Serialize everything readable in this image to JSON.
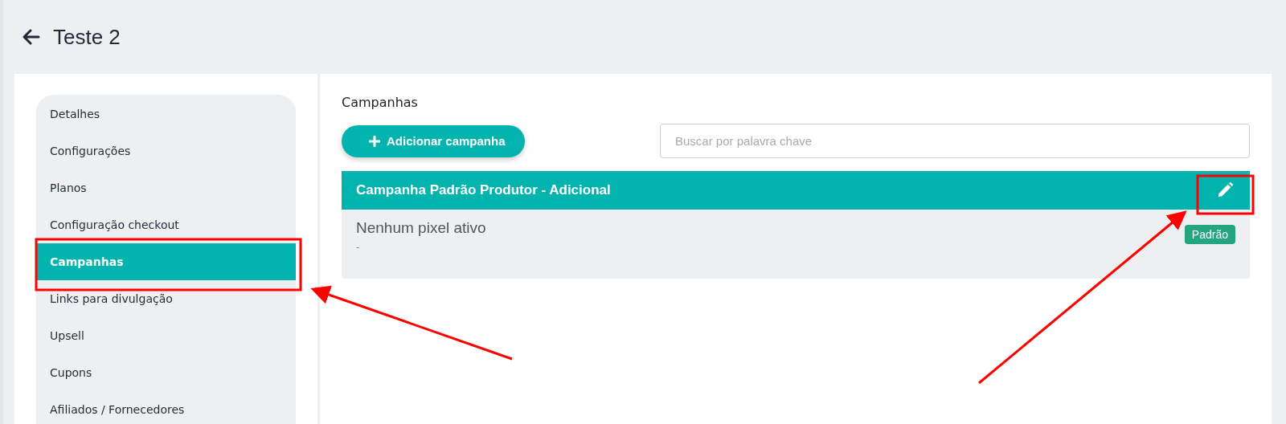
{
  "page": {
    "title": "Teste 2"
  },
  "sidebar": {
    "items": [
      {
        "label": "Detalhes",
        "selected": false
      },
      {
        "label": "Configurações",
        "selected": false
      },
      {
        "label": "Planos",
        "selected": false
      },
      {
        "label": "Configuração checkout",
        "selected": false
      },
      {
        "label": "Campanhas",
        "selected": true
      },
      {
        "label": "Links para divulgação",
        "selected": false
      },
      {
        "label": "Upsell",
        "selected": false
      },
      {
        "label": "Cupons",
        "selected": false
      },
      {
        "label": "Afiliados / Fornecedores",
        "selected": false
      }
    ]
  },
  "main": {
    "heading": "Campanhas",
    "add_button": "Adicionar campanha",
    "search": {
      "placeholder": "Buscar por palavra chave"
    },
    "campaigns": [
      {
        "name": "Campanha Padrão Produtor - Adicional",
        "pixels": "Nenhum pixel ativo",
        "detail": "-",
        "badge": "Padrão"
      }
    ]
  }
}
